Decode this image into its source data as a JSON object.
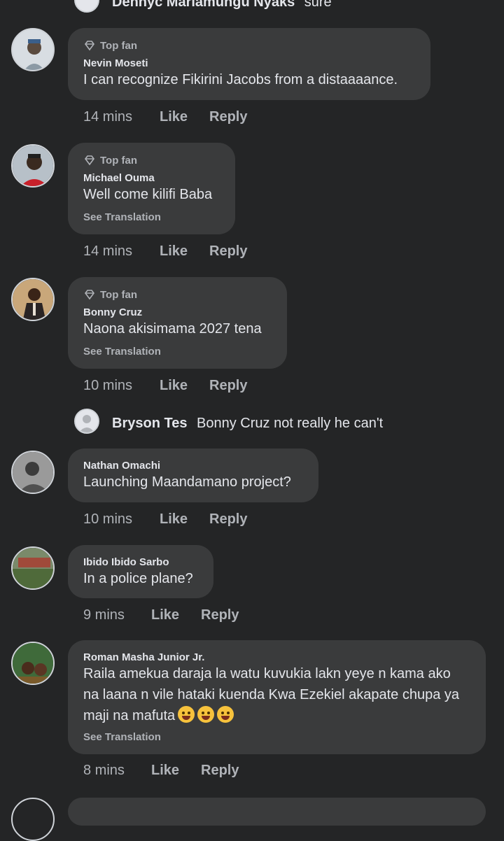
{
  "top_reply": {
    "name": "Dennyc Mariamungu Nyaks",
    "text": "sure"
  },
  "badge_label": "Top fan",
  "action_like": "Like",
  "action_reply": "Reply",
  "see_translation": "See Translation",
  "comments": [
    {
      "name": "Nevin Moseti",
      "text": "I can recognize Fikirini Jacobs from a distaaaance.",
      "time": "14 mins",
      "top_fan": true
    },
    {
      "name": "Michael Ouma",
      "text": "Well come kilifi Baba",
      "time": "14 mins",
      "top_fan": true,
      "translation": true
    },
    {
      "name": "Bonny Cruz",
      "text": "Naona akisimama 2027 tena",
      "time": "10 mins",
      "top_fan": true,
      "translation": true
    },
    {
      "name": "Nathan Omachi",
      "text": "Launching Maandamano project?",
      "time": "10 mins"
    },
    {
      "name": "Ibido Ibido Sarbo",
      "text": "In a police plane?",
      "time": "9 mins"
    },
    {
      "name": "Roman Masha Junior Jr.",
      "text_lines": [
        "Raila amekua daraja la watu kuvukia lakn yeye n kama ako",
        "na laana n vile hataki kuenda Kwa Ezekiel akapate chupa ya",
        "maji na mafuta"
      ],
      "emojis": [
        "crying-cat-emoji",
        "crying-cat-emoji",
        "crying-cat-emoji"
      ],
      "time": "8 mins",
      "translation": true
    }
  ],
  "nested_reply": {
    "name": "Bryson Tes",
    "text": "Bonny Cruz not really he can't"
  }
}
